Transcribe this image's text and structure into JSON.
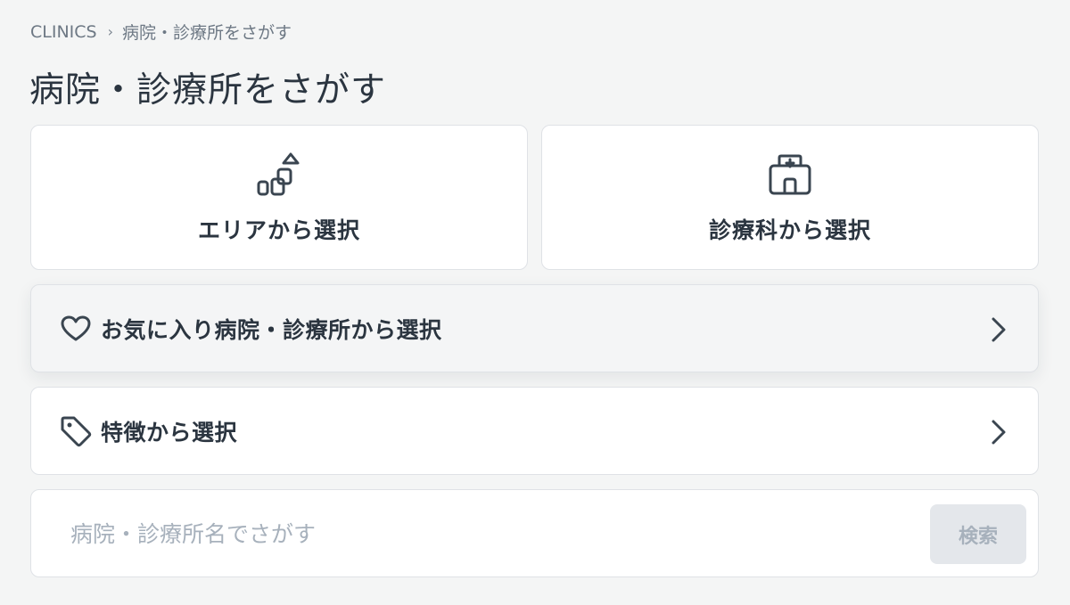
{
  "breadcrumb": {
    "root": "CLINICS",
    "separator": "›",
    "current": "病院・診療所をさがす"
  },
  "title": "病院・診療所をさがす",
  "tiles": [
    {
      "icon": "area-map-icon",
      "label": "エリアから選択"
    },
    {
      "icon": "hospital-icon",
      "label": "診療科から選択"
    }
  ],
  "rows": [
    {
      "icon": "heart-icon",
      "label": "お気に入り病院・診療所から選択"
    },
    {
      "icon": "tag-icon",
      "label": "特徴から選択"
    }
  ],
  "search": {
    "placeholder": "病院・診療所名でさがす",
    "value": "",
    "button_label": "検索"
  },
  "colors": {
    "background": "#f4f5f5",
    "text": "#2b3540",
    "muted": "#6d7884",
    "placeholder": "#a7b1bc",
    "card_border": "#dfe2e6",
    "button_bg": "#e4e7eb"
  }
}
